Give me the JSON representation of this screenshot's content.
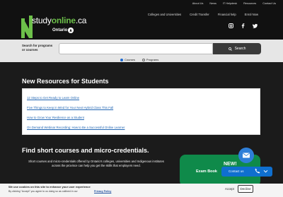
{
  "header": {
    "logo_prefix": "study",
    "logo_highlight": "online",
    "logo_suffix": ".ca",
    "logo_sub": "Ontario",
    "top_links": [
      "About Us",
      "News",
      "IT Helpdesk",
      "Resources",
      "Contact Us"
    ],
    "main_nav": [
      "Colleges and Universities",
      "Credit Transfer",
      "Financial help",
      "Enrol Now"
    ],
    "social_icons": [
      "instagram-icon",
      "facebook-icon",
      "twitter-icon"
    ]
  },
  "search": {
    "label": "Search for programs or courses",
    "value": "",
    "button_label": "Search",
    "options": [
      "Courses",
      "Programs"
    ],
    "selected": "Courses"
  },
  "resources": {
    "title": "New Resources for Students",
    "links": [
      "12 Steps to Get Ready to Learn Online",
      "Five Things to Keep in Mind for Your Next Hybrid Class This Fall",
      "How to Grow Your Resilience as a Student",
      "On Demand Webinar Recording: How to Be a Successful Online Learner"
    ]
  },
  "courses": {
    "title": "Find short courses and micro-credentials.",
    "description": "Short courses and micro-credentials offered by Ontario's colleges, universities and Indigenous institutes across the province can help you get the skills that employers need."
  },
  "promo": {
    "badge": "NEW!",
    "title": "Exam Book"
  },
  "chat": {
    "label": "Contact us"
  },
  "cookie": {
    "line1": "We use cookies on this site to enhance your user experience",
    "line2": "By clicking \"Accept\" you agree to us doing so as outlined in our",
    "policy_link": "Privacy Policy",
    "accept_label": "Accept",
    "decline_label": "Decline"
  },
  "colors": {
    "brand_green": "#6dc04a",
    "promo_green": "#0f8a4a",
    "link_blue": "#2266b3",
    "chat_blue": "#0f6fcf"
  }
}
